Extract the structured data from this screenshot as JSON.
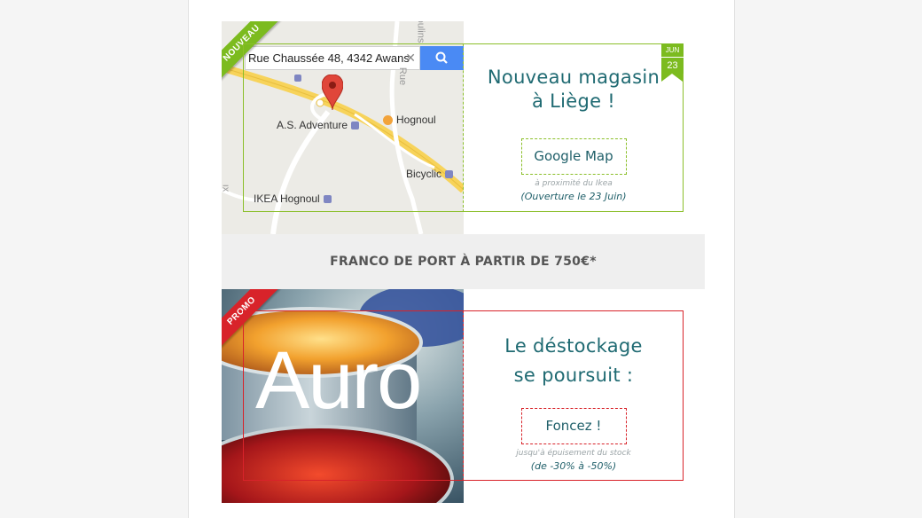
{
  "map_card": {
    "ribbon_label": "NOUVEAU",
    "search_value": "Rue Chaussée 48, 4342 Awans",
    "search_clear": "✕",
    "labels": {
      "as_adventure": "A.S. Adventure",
      "hognoul": "Hognoul",
      "bicyclic": "Bicyclic",
      "ikea": "IKEA Hognoul",
      "road_rue": "Rue",
      "road_moulins": "oulins",
      "road_x": "ıx"
    },
    "date_month": "JUN",
    "date_day": "23",
    "headline_line1": "Nouveau magasin",
    "headline_line2": "à Liège !",
    "cta_label": "Google Map",
    "note_small": "à proximité du Ikea",
    "note": "(Ouverture le 23 Juin)"
  },
  "shipping_banner": "FRANCO DE PORT À PARTIR DE 750€*",
  "promo_card": {
    "ribbon_label": "PROMO",
    "brand_logo": "Auro",
    "headline_line1": "Le déstockage",
    "headline_line2": "se poursuit :",
    "cta_label": "Foncez !",
    "note_small": "jusqu'à épuisement du stock",
    "note": "(de -30% à -50%)"
  },
  "colors": {
    "accent_green": "#7cbb1f",
    "accent_red": "#d8232a",
    "text_teal": "#1f6a72"
  },
  "icons": {
    "search": "search-icon",
    "map_pin": "map-pin-icon",
    "clear": "close-icon"
  }
}
